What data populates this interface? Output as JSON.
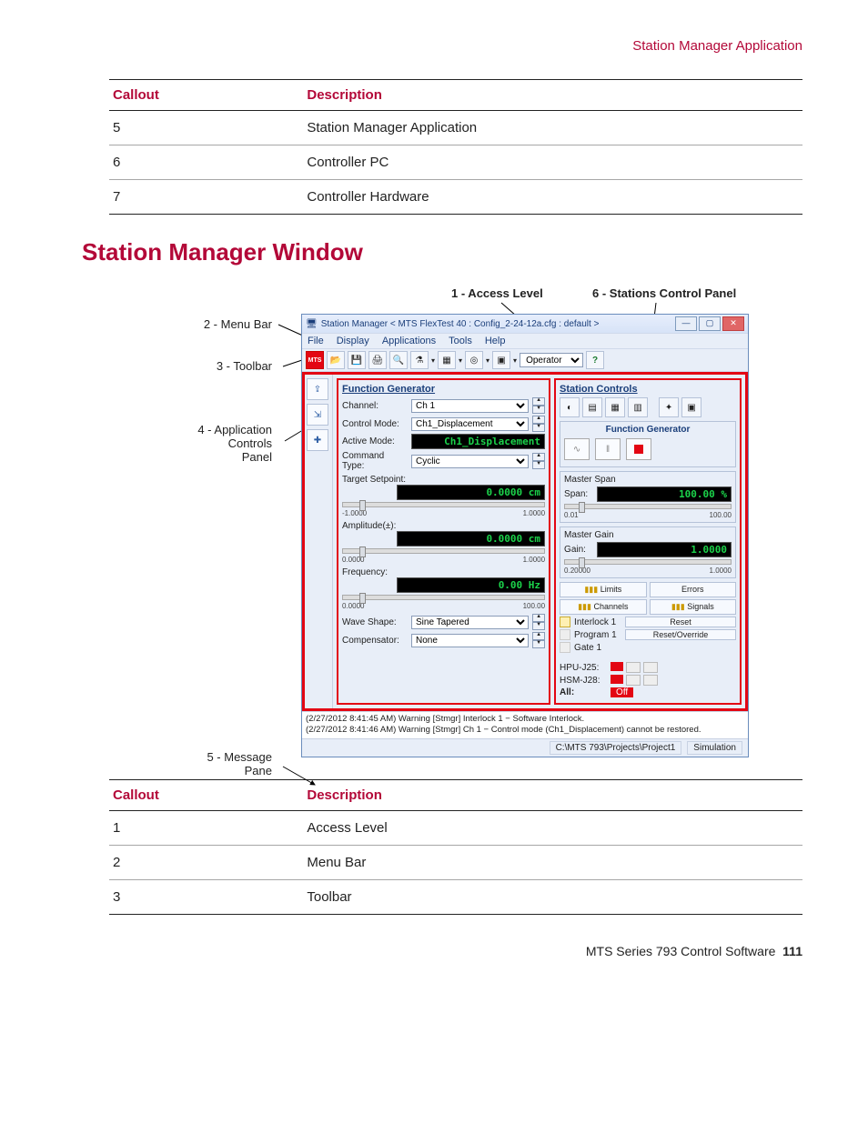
{
  "header_right": "Station Manager Application",
  "table1": {
    "cols": [
      "Callout",
      "Description"
    ],
    "rows": [
      [
        "5",
        "Station Manager Application"
      ],
      [
        "6",
        "Controller PC"
      ],
      [
        "7",
        "Controller Hardware"
      ]
    ]
  },
  "section_heading": "Station Manager Window",
  "callouts": {
    "top1": "1 - Access Level",
    "top6": "6 - Stations Control Panel",
    "c2": "2 - Menu Bar",
    "c3": "3 - Toolbar",
    "c4a": "4 - Application",
    "c4b": "Controls",
    "c4c": "Panel",
    "c5a": "5 - Message",
    "c5b": "Pane"
  },
  "win": {
    "title": "Station Manager < MTS FlexTest 40 : Config_2-24-12a.cfg : default >",
    "menus": [
      "File",
      "Display",
      "Applications",
      "Tools",
      "Help"
    ],
    "toolbar": {
      "mts": "MTS",
      "access_level": "Operator"
    },
    "fg": {
      "title": "Function Generator",
      "channel_label": "Channel:",
      "channel": "Ch 1",
      "ctrlmode_label": "Control Mode:",
      "ctrlmode": "Ch1_Displacement",
      "activemode_label": "Active Mode:",
      "activemode": "Ch1_Displacement",
      "cmdtype_label": "Command Type:",
      "cmdtype": "Cyclic",
      "target_label": "Target Setpoint:",
      "target_val": "0.0000 cm",
      "target_min": "-1.0000",
      "target_max": "1.0000",
      "amp_label": "Amplitude(±):",
      "amp_val": "0.0000 cm",
      "amp_min": "0.0000",
      "amp_max": "1.0000",
      "freq_label": "Frequency:",
      "freq_val": "0.00 Hz",
      "freq_min": "0.0000",
      "freq_max": "100.00",
      "wave_label": "Wave Shape:",
      "wave": "Sine Tapered",
      "comp_label": "Compensator:",
      "comp": "None"
    },
    "sc": {
      "title": "Station Controls",
      "fg_group": "Function Generator",
      "master_span_title": "Master Span",
      "span_label": "Span:",
      "span_val": "100.00 %",
      "span_min": "0.01",
      "span_max": "100.00",
      "master_gain_title": "Master Gain",
      "gain_label": "Gain:",
      "gain_val": "1.0000",
      "gain_min": "0.20000",
      "gain_max": "1.0000",
      "limits": "Limits",
      "errors": "Errors",
      "channels": "Channels",
      "signals": "Signals",
      "interlock": "Interlock 1",
      "reset": "Reset",
      "program": "Program 1",
      "reset_ov": "Reset/Override",
      "gate": "Gate 1",
      "hpu": "HPU-J25:",
      "hsm": "HSM-J28:",
      "all": "All:",
      "off": "Off"
    },
    "messages": [
      "(2/27/2012 8:41:45 AM) Warning [Stmgr] Interlock 1 − Software Interlock.",
      "(2/27/2012 8:41:46 AM) Warning [Stmgr] Ch 1 − Control mode (Ch1_Displacement) cannot be restored."
    ],
    "status_path": "C:\\MTS 793\\Projects\\Project1",
    "status_mode": "Simulation"
  },
  "table2": {
    "cols": [
      "Callout",
      "Description"
    ],
    "rows": [
      [
        "1",
        "Access Level"
      ],
      [
        "2",
        "Menu Bar"
      ],
      [
        "3",
        "Toolbar"
      ]
    ]
  },
  "footer_text": "MTS Series 793 Control Software",
  "footer_page": "111"
}
